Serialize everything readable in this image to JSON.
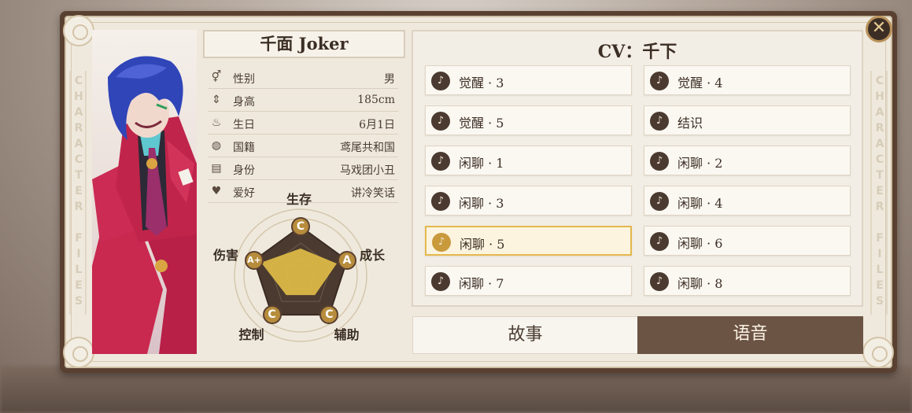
{
  "character": {
    "name": "千面 Joker",
    "info": [
      {
        "icon": "gender-icon",
        "glyph": "⚥",
        "label": "性别",
        "value": "男"
      },
      {
        "icon": "height-icon",
        "glyph": "⇕",
        "label": "身高",
        "value": "185cm"
      },
      {
        "icon": "cake-icon",
        "glyph": "♨",
        "label": "生日",
        "value": "6月1日"
      },
      {
        "icon": "globe-icon",
        "glyph": "◍",
        "label": "国籍",
        "value": "鸢尾共和国"
      },
      {
        "icon": "id-card-icon",
        "glyph": "▤",
        "label": "身份",
        "value": "马戏团小丑"
      },
      {
        "icon": "heart-icon",
        "glyph": "♥",
        "label": "爱好",
        "value": "讲冷笑话"
      }
    ]
  },
  "radar": {
    "axes": [
      {
        "label": "生存",
        "grade": "C",
        "level": 0.55
      },
      {
        "label": "成长",
        "grade": "A",
        "level": 0.78
      },
      {
        "label": "辅助",
        "grade": "C",
        "level": 0.5
      },
      {
        "label": "控制",
        "grade": "C",
        "level": 0.5
      },
      {
        "label": "伤害",
        "grade": "A+",
        "level": 0.85
      }
    ]
  },
  "voice": {
    "cv_title": "CV：千下",
    "items": [
      {
        "label": "觉醒 · 3",
        "active": false
      },
      {
        "label": "觉醒 · 4",
        "active": false
      },
      {
        "label": "觉醒 · 5",
        "active": false
      },
      {
        "label": "结识",
        "active": false
      },
      {
        "label": "闲聊 · 1",
        "active": false
      },
      {
        "label": "闲聊 · 2",
        "active": false
      },
      {
        "label": "闲聊 · 3",
        "active": false
      },
      {
        "label": "闲聊 · 4",
        "active": false
      },
      {
        "label": "闲聊 · 5",
        "active": true
      },
      {
        "label": "闲聊 · 6",
        "active": false
      },
      {
        "label": "闲聊 · 7",
        "active": false
      },
      {
        "label": "闲聊 · 8",
        "active": false
      }
    ]
  },
  "tabs": {
    "story": "故事",
    "voice": "语音",
    "selected": "voice"
  },
  "side_text": "CHARACTER FILES",
  "close_glyph": "✕",
  "colors": {
    "accent": "#c99a3c",
    "panel": "#efe9dd",
    "dark": "#6c5444"
  }
}
